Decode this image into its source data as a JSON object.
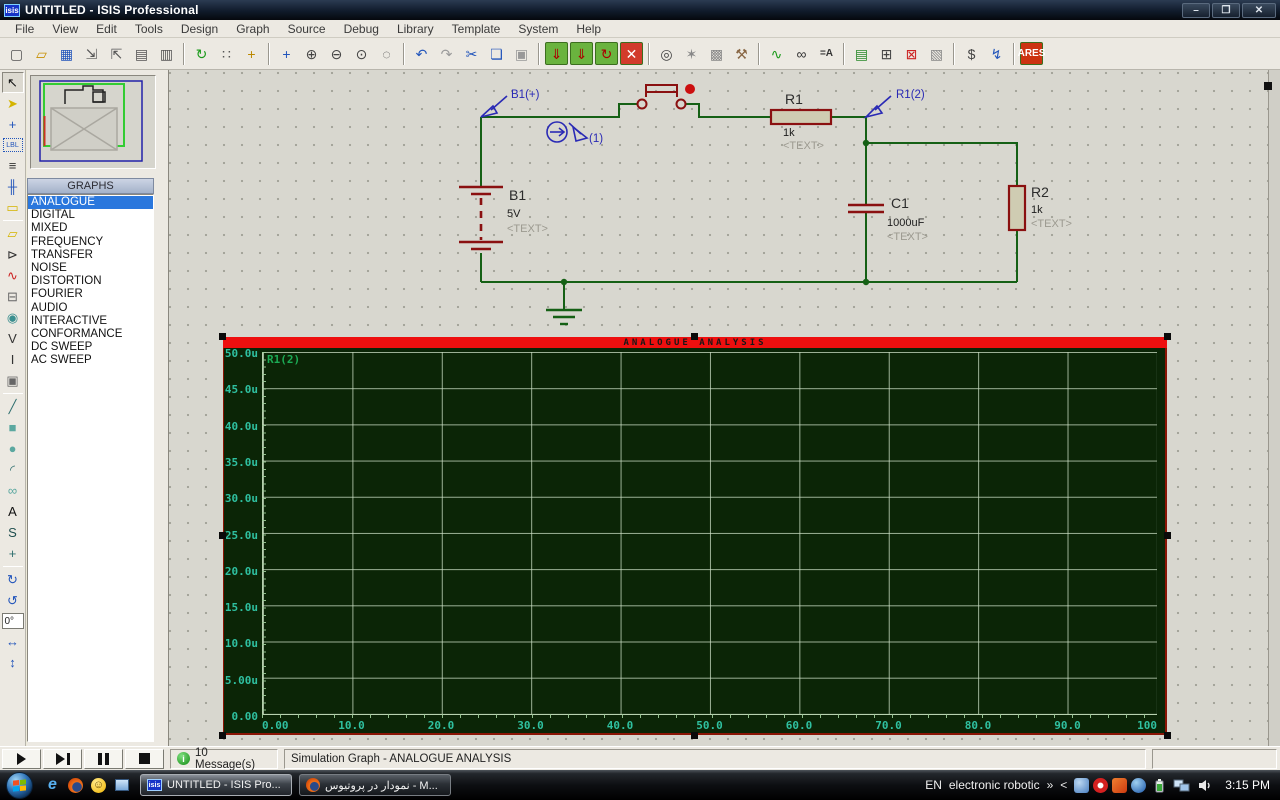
{
  "window": {
    "title": "UNTITLED - ISIS Professional",
    "logo": "isis"
  },
  "menu": {
    "items": [
      "File",
      "View",
      "Edit",
      "Tools",
      "Design",
      "Graph",
      "Source",
      "Debug",
      "Library",
      "Template",
      "System",
      "Help"
    ]
  },
  "toolbar": {
    "groups": [
      [
        "new-file",
        "open-file",
        "save-file",
        "import-section",
        "export-section",
        "print",
        "mark-output-area"
      ],
      [
        "redraw",
        "grid-toggle",
        "origin"
      ],
      [
        "pan",
        "zoom-in",
        "zoom-out",
        "zoom-all",
        "zoom-area"
      ],
      [
        "undo",
        "redo",
        "cut",
        "copy",
        "paste"
      ],
      [
        "block-copy",
        "block-move",
        "block-rotate",
        "block-delete"
      ],
      [
        "pick-device",
        "make-device",
        "packaging-tool",
        "decompose"
      ],
      [
        "wire-autorouter",
        "search-tag",
        "property-assignment"
      ],
      [
        "design-explorer",
        "new-sheet",
        "remove-sheet",
        "goto-sheet"
      ],
      [
        "bill-of-materials",
        "electrical-rule-check"
      ],
      [
        "netlist-to-ares"
      ]
    ]
  },
  "sidebar": {
    "selector_header": "GRAPHS",
    "graph_types": [
      "ANALOGUE",
      "DIGITAL",
      "MIXED",
      "FREQUENCY",
      "TRANSFER",
      "NOISE",
      "DISTORTION",
      "FOURIER",
      "AUDIO",
      "INTERACTIVE",
      "CONFORMANCE",
      "DC SWEEP",
      "AC SWEEP"
    ],
    "selected_index": 0,
    "rotation_angle": "0°",
    "tools": [
      "selection-pointer",
      "component-mode",
      "junction-dot-mode",
      "wire-label-mode",
      "text-script-mode",
      "bus-mode",
      "subcircuit-mode",
      "|",
      "terminal-mode",
      "device-pin-mode",
      "graph-mode",
      "tape-recorder-mode",
      "generator-mode",
      "voltage-probe-mode",
      "current-probe-mode",
      "virtual-instruments-mode",
      "|",
      "2d-line",
      "2d-box",
      "2d-circle",
      "2d-arc",
      "2d-path",
      "2d-text",
      "2d-symbol",
      "2d-marker",
      "|",
      "rotate-cw",
      "rotate-ccw",
      "angle-display",
      "mirror-horizontal",
      "mirror-vertical"
    ]
  },
  "circuit": {
    "components": {
      "b1": {
        "ref": "B1",
        "value": "5V",
        "text": "<TEXT>"
      },
      "r1": {
        "ref": "R1",
        "value": "1k",
        "text": "<TEXT>"
      },
      "c1": {
        "ref": "C1",
        "value": "1000uF",
        "text": "<TEXT>"
      },
      "r2": {
        "ref": "R2",
        "value": "1k",
        "text": "<TEXT>"
      }
    },
    "probes": {
      "vp_b1": {
        "label": "B1(+)"
      },
      "ip_1": {
        "label": "(1)"
      },
      "vp_r1": {
        "label": "R1(2)"
      }
    }
  },
  "graph": {
    "title": "ANALOGUE ANALYSIS",
    "legend": "R1(2)",
    "y_ticks": [
      "50.0u",
      "45.0u",
      "40.0u",
      "35.0u",
      "30.0u",
      "25.0u",
      "20.0u",
      "15.0u",
      "10.0u",
      "5.00u",
      "0.00"
    ],
    "x_ticks": [
      "0.00",
      "10.0",
      "20.0",
      "30.0",
      "40.0",
      "50.0",
      "60.0",
      "70.0",
      "80.0",
      "90.0",
      "100"
    ]
  },
  "chart_data": {
    "type": "line",
    "title": "ANALOGUE ANALYSIS",
    "series": [
      {
        "name": "R1(2)",
        "x": [],
        "y": []
      }
    ],
    "x_range": [
      0,
      100
    ],
    "y_axis_labels": [
      "0.00",
      "5.00u",
      "10.0u",
      "15.0u",
      "20.0u",
      "25.0u",
      "30.0u",
      "35.0u",
      "40.0u",
      "45.0u",
      "50.0u"
    ],
    "grid": true,
    "legend_position": "top-left"
  },
  "statusbar": {
    "controls": [
      "play",
      "step",
      "pause",
      "stop"
    ],
    "messages": "10 Message(s)",
    "status": "Simulation Graph - ANALOGUE ANALYSIS"
  },
  "taskbar": {
    "quick_launch": [
      "internet-explorer",
      "firefox",
      "messenger",
      "show-desktop"
    ],
    "buttons": [
      {
        "icon": "isis",
        "label": "UNTITLED - ISIS Pro...",
        "active": true
      },
      {
        "icon": "firefox",
        "label": "نمودار در پروتيوس - M...",
        "active": false
      }
    ],
    "language": "EN",
    "desktop_text": "electronic  robotic",
    "overflow_chevron": "»",
    "collapse_chevron": "<",
    "tray_icons": [
      "tray-app-blue",
      "tray-app-red",
      "tray-app-orange",
      "tray-app-sphere"
    ],
    "time": "3:15 PM"
  }
}
